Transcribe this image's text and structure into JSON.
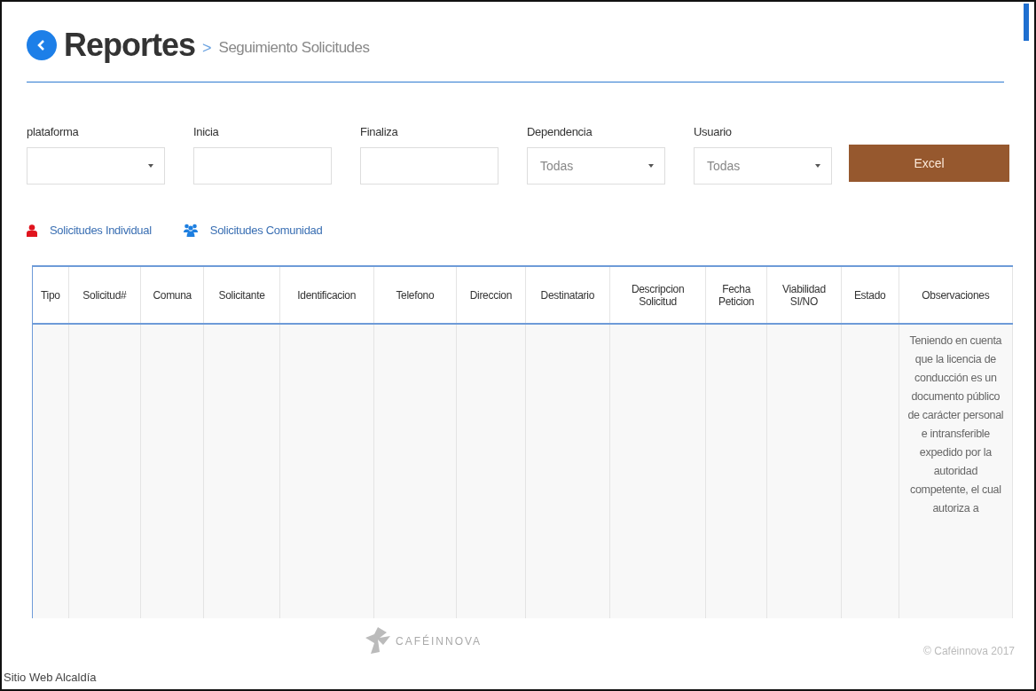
{
  "header": {
    "title": "Reportes",
    "separator": ">",
    "subtitle": "Seguimiento Solicitudes"
  },
  "filters": [
    {
      "label": "plataforma",
      "kind": "select"
    },
    {
      "label": "Inicia",
      "kind": "input"
    },
    {
      "label": "Finaliza",
      "kind": "input"
    },
    {
      "label": "Dependencia",
      "kind": "select",
      "value": "Todas"
    },
    {
      "label": "Usuario",
      "kind": "select",
      "value": "Todas"
    }
  ],
  "export_button": "Excel",
  "links": [
    {
      "label": "Solicitudes Individual",
      "kind": "person",
      "color": "#e0141e"
    },
    {
      "label": "Solicitudes Comunidad",
      "kind": "group",
      "color": "#1e7fe0"
    }
  ],
  "table": {
    "columns": [
      "Tipo",
      "Solicitud#",
      "Comuna",
      "Solicitante",
      "Identificacion",
      "Telefono",
      "Direccion",
      "Destinatario",
      "Descripcion Solicitud",
      "Fecha Peticion",
      "Viabilidad SI/NO",
      "Estado",
      "Observaciones"
    ],
    "rows": [
      [
        "",
        "",
        "",
        "",
        "",
        "",
        "",
        "",
        "",
        "",
        "",
        "",
        "Teniendo en cuenta que la licencia de conducción es un documento público de carácter personal e intransferible expedido por la autoridad competente, el cual autoriza a"
      ]
    ]
  },
  "footer": {
    "left": "Sitio Web Alcaldía",
    "logo": "CAFÉINNOVA",
    "right": "© Caféinnova 2017"
  }
}
